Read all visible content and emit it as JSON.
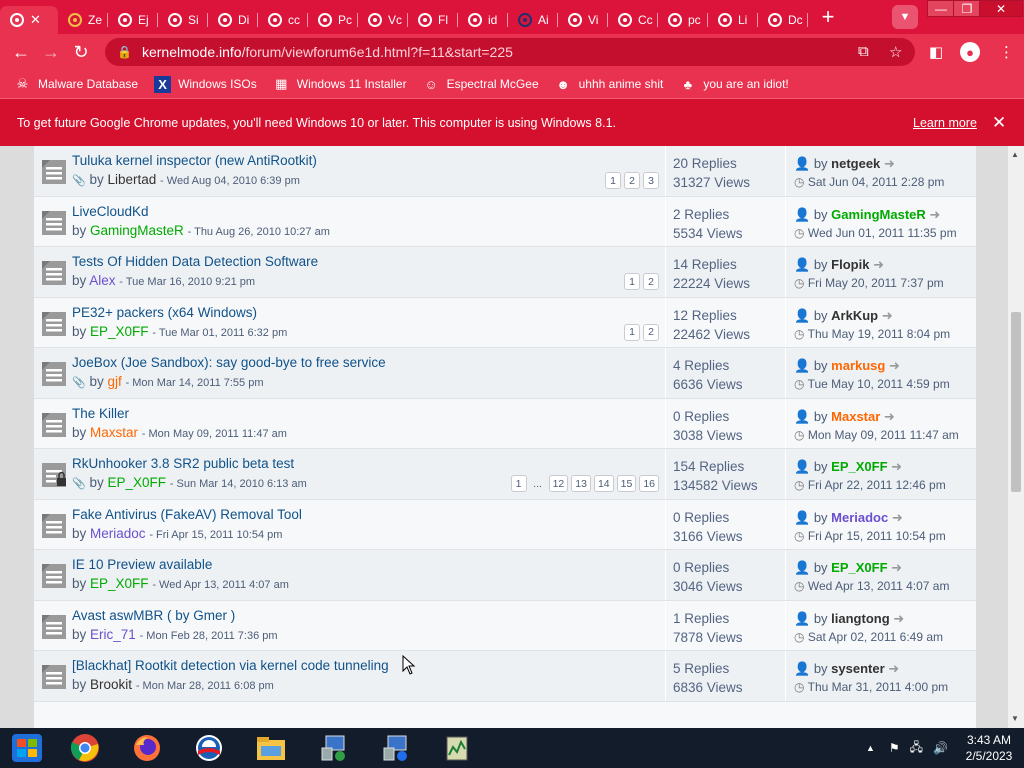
{
  "browser": {
    "tabs": [
      {
        "label": "",
        "active": true
      },
      {
        "label": "Ze"
      },
      {
        "label": "Ej"
      },
      {
        "label": "Si"
      },
      {
        "label": "Di"
      },
      {
        "label": "cc"
      },
      {
        "label": "Pc"
      },
      {
        "label": "Vc"
      },
      {
        "label": "Fl"
      },
      {
        "label": "id"
      },
      {
        "label": "Ai"
      },
      {
        "label": "Vi"
      },
      {
        "label": "Cc"
      },
      {
        "label": "pc"
      },
      {
        "label": "Li"
      },
      {
        "label": "Dc"
      }
    ],
    "url_host": "kernelmode.info",
    "url_path": "/forum/viewforum6e1d.html?f=11&start=225",
    "bookmarks": [
      {
        "label": "Malware Database"
      },
      {
        "label": "Windows ISOs"
      },
      {
        "label": "Windows 11 Installer"
      },
      {
        "label": "Espectral McGee"
      },
      {
        "label": "uhhh anime shit"
      },
      {
        "label": "you are an idiot!"
      }
    ],
    "infobar_text": "To get future Google Chrome updates, you'll need Windows 10 or later. This computer is using Windows 8.1.",
    "infobar_link": "Learn more"
  },
  "forum": {
    "topics": [
      {
        "title": "Tuluka kernel inspector (new AntiRootkit)",
        "attach": true,
        "author": "Libertad",
        "author_class": "u-black",
        "date": "- Wed Aug 04, 2010 6:39 pm",
        "pages": [
          "1",
          "2",
          "3"
        ],
        "replies": "20 Replies",
        "views": "31327 Views",
        "last_user": "netgeek",
        "last_class": "u-black",
        "last_date": "Sat Jun 04, 2011 2:28 pm"
      },
      {
        "title": "LiveCloudKd",
        "attach": false,
        "author": "GamingMasteR",
        "author_class": "u-green",
        "date": "- Thu Aug 26, 2010 10:27 am",
        "pages": [],
        "replies": "2 Replies",
        "views": "5534 Views",
        "last_user": "GamingMasteR",
        "last_class": "u-green",
        "last_date": "Wed Jun 01, 2011 11:35 pm"
      },
      {
        "title": "Tests Of Hidden Data Detection Software",
        "attach": false,
        "author": "Alex",
        "author_class": "u-purple",
        "date": "- Tue Mar 16, 2010 9:21 pm",
        "pages": [
          "1",
          "2"
        ],
        "replies": "14 Replies",
        "views": "22224 Views",
        "last_user": "Flopik",
        "last_class": "u-black",
        "last_date": "Fri May 20, 2011 7:37 pm"
      },
      {
        "title": "PE32+ packers (x64 Windows)",
        "attach": false,
        "author": "EP_X0FF",
        "author_class": "u-green",
        "date": "- Tue Mar 01, 2011 6:32 pm",
        "pages": [
          "1",
          "2"
        ],
        "replies": "12 Replies",
        "views": "22462 Views",
        "last_user": "ArkKup",
        "last_class": "u-black",
        "last_date": "Thu May 19, 2011 8:04 pm"
      },
      {
        "title": "JoeBox (Joe Sandbox): say good-bye to free service",
        "attach": true,
        "author": "gjf",
        "author_class": "u-orange",
        "date": "- Mon Mar 14, 2011 7:55 pm",
        "pages": [],
        "replies": "4 Replies",
        "views": "6636 Views",
        "last_user": "markusg",
        "last_class": "u-orange",
        "last_date": "Tue May 10, 2011 4:59 pm"
      },
      {
        "title": "The Killer",
        "attach": false,
        "author": "Maxstar",
        "author_class": "u-orange",
        "date": "- Mon May 09, 2011 11:47 am",
        "pages": [],
        "replies": "0 Replies",
        "views": "3038 Views",
        "last_user": "Maxstar",
        "last_class": "u-orange",
        "last_date": "Mon May 09, 2011 11:47 am"
      },
      {
        "title": "RkUnhooker 3.8 SR2 public beta test",
        "attach": true,
        "locked": true,
        "author": "EP_X0FF",
        "author_class": "u-green",
        "date": "- Sun Mar 14, 2010 6:13 am",
        "pages": [
          "1",
          "...",
          "12",
          "13",
          "14",
          "15",
          "16"
        ],
        "replies": "154 Replies",
        "views": "134582 Views",
        "last_user": "EP_X0FF",
        "last_class": "u-green",
        "last_date": "Fri Apr 22, 2011 12:46 pm"
      },
      {
        "title": "Fake Antivirus (FakeAV) Removal Tool",
        "attach": false,
        "author": "Meriadoc",
        "author_class": "u-purple",
        "date": "- Fri Apr 15, 2011 10:54 pm",
        "pages": [],
        "replies": "0 Replies",
        "views": "3166 Views",
        "last_user": "Meriadoc",
        "last_class": "u-purple",
        "last_date": "Fri Apr 15, 2011 10:54 pm"
      },
      {
        "title": "IE 10 Preview available",
        "attach": false,
        "author": "EP_X0FF",
        "author_class": "u-green",
        "date": "- Wed Apr 13, 2011 4:07 am",
        "pages": [],
        "replies": "0 Replies",
        "views": "3046 Views",
        "last_user": "EP_X0FF",
        "last_class": "u-green",
        "last_date": "Wed Apr 13, 2011 4:07 am"
      },
      {
        "title": "Avast aswMBR ( by Gmer )",
        "attach": false,
        "author": "Eric_71",
        "author_class": "u-purple",
        "date": "- Mon Feb 28, 2011 7:36 pm",
        "pages": [],
        "replies": "1 Replies",
        "views": "7878 Views",
        "last_user": "liangtong",
        "last_class": "u-black",
        "last_date": "Sat Apr 02, 2011 6:49 am"
      },
      {
        "title": "[Blackhat] Rootkit detection via kernel code tunneling",
        "attach": false,
        "author": "Brookit",
        "author_class": "u-black",
        "date": "- Mon Mar 28, 2011 6:08 pm",
        "pages": [],
        "replies": "5 Replies",
        "views": "6836 Views",
        "last_user": "sysenter",
        "last_class": "u-black",
        "last_date": "Thu Mar 31, 2011 4:00 pm"
      }
    ]
  },
  "taskbar": {
    "time": "3:43 AM",
    "date": "2/5/2023"
  },
  "colors": {
    "chrome_red": "#dc143c",
    "link_blue": "#105289",
    "green_user": "#00aa00",
    "orange_user": "#ff6600"
  }
}
